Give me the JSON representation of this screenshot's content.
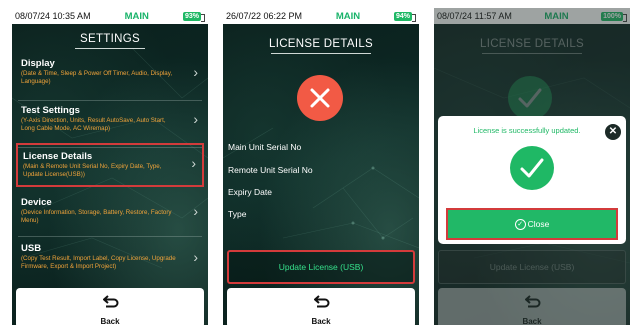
{
  "screens": [
    {
      "status": {
        "time": "08/07/24 10:35 AM",
        "mode": "MAIN",
        "battery": "93%"
      },
      "title": "SETTINGS",
      "menu": [
        {
          "label": "Display",
          "desc": "(Date & Time, Sleep & Power Off Timer, Audio, Display, Language)"
        },
        {
          "label": "Test Settings",
          "desc": "(Y-Axis Direction, Units, Result AutoSave, Auto Start, Long Cable Mode, AC Wiremap)"
        },
        {
          "label": "License Details",
          "desc": "(Main & Remote Unit Serial No, Expiry Date, Type, Update License(USB))"
        },
        {
          "label": "Device",
          "desc": "(Device Information, Storage, Battery, Restore, Factory Menu)"
        },
        {
          "label": "USB",
          "desc": "(Copy Test Result, Import Label, Copy License, Upgrade Firmware, Export & Import Project)"
        }
      ],
      "back_label": "Back"
    },
    {
      "status": {
        "time": "26/07/22 06:22 PM",
        "mode": "MAIN",
        "battery": "94%"
      },
      "title": "LICENSE DETAILS",
      "fields": [
        "Main Unit Serial No",
        "Remote Unit Serial No",
        "Expiry Date",
        "Type"
      ],
      "update_button": "Update License (USB)",
      "back_label": "Back"
    },
    {
      "status": {
        "time": "08/07/24 11:57 AM",
        "mode": "MAIN",
        "battery": "100%"
      },
      "title": "LICENSE DETAILS",
      "modal": {
        "message": "License is successfully updated.",
        "close_button": "Close"
      },
      "update_button": "Update License (USB)",
      "back_label": "Back"
    }
  ],
  "colors": {
    "accent_green": "#1fb865",
    "highlight_red": "#d33b3b",
    "desc_orange": "#f0a33a",
    "error_red": "#f25a45"
  }
}
